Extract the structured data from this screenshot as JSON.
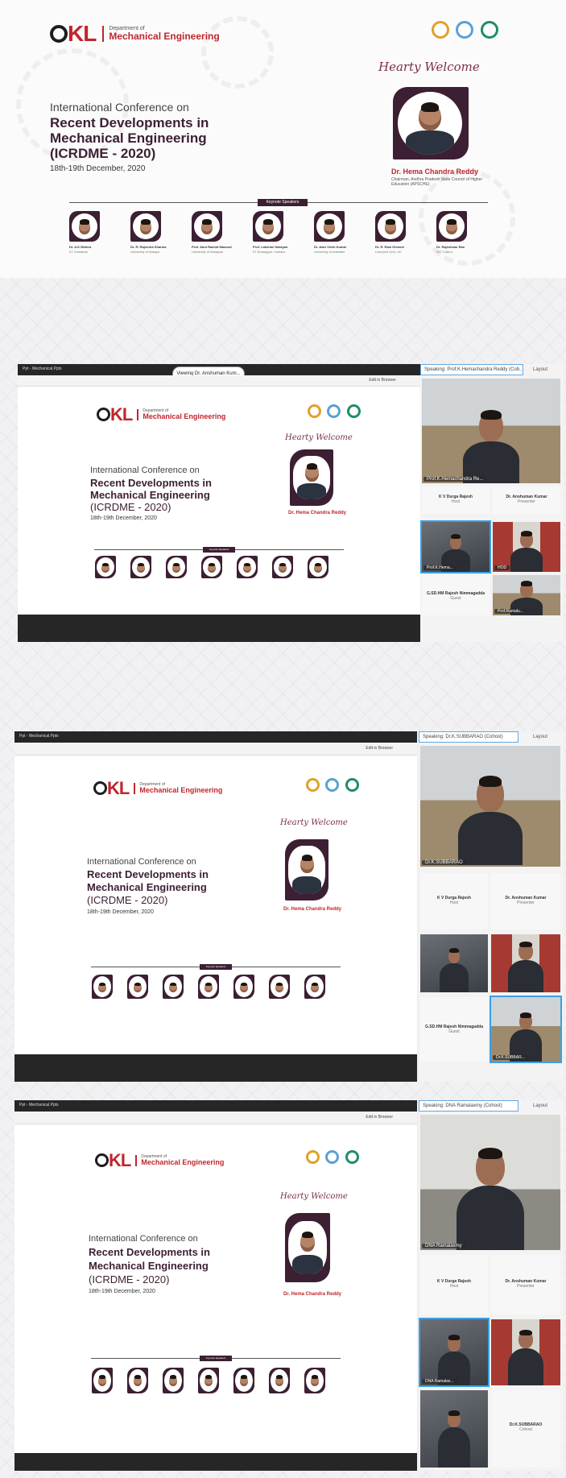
{
  "poster": {
    "logo_text": "KL",
    "logo_o": "O",
    "dept_small": "Department of",
    "dept_big": "Mechanical Engineering",
    "welcome": "Hearty Welcome",
    "conf_line1": "International Conference on",
    "conf_line2": "Recent Developments in",
    "conf_line3": "Mechanical Engineering",
    "conf_line4": "(ICRDME - 2020)",
    "conf_date": "18th-19th December, 2020",
    "chief_name": "Dr. Hema Chandra Reddy",
    "chief_role": "Chairman, Andhra Pradesh State Council of Higher Education (APSCHE)",
    "speakers_tag": "Keynote Speakers",
    "speakers": [
      {
        "name": "Dr. A.K Mishra",
        "aff": "IIT Guwahati"
      },
      {
        "name": "Dr. R. Rajendra Sharma",
        "aff": "University of Malaya"
      },
      {
        "name": "Prof. Abul Rashid Masood",
        "aff": "University of Malaysia"
      },
      {
        "name": "Prof. Lakshmi Narayan",
        "aff": "IIT Kharagpur, Kolkata"
      },
      {
        "name": "Dr. Alan Vivek Kumar",
        "aff": "University of Adelaide"
      },
      {
        "name": "Dr. R. Ram Kishore",
        "aff": "Liverpool Univ, UK"
      },
      {
        "name": "Dr. Rajeshwar Rao",
        "aff": "NIT Calicut"
      }
    ]
  },
  "meetings": [
    {
      "viewing": "Viewing Dr. Anshuman Kum...",
      "speaking": "Speaking: Prof.K.Hemachandra Reddy (Cob...",
      "layout": "Layout",
      "main_label": "Prof.K.Hemachandra Re...",
      "window_title": "Ppt - Mechanical.Pptx",
      "toolbar_right": "Edit in Browser",
      "tiles": [
        {
          "name": "K V Durga Rajesh",
          "role": "Host"
        },
        {
          "name": "Dr. Anshuman Kumar",
          "role": "Presenter"
        }
      ],
      "small_label_1": "Prof.K.Hema...",
      "small_label_2": "HOD",
      "bottom_tile": {
        "name": "G.SD.HM Rajesh Nimmagadda",
        "role": "Guest"
      },
      "bottom_label": "Prof.Ramalu..."
    },
    {
      "speaking": "Speaking: Dr.K.SUBBARAO (Cohost)",
      "layout": "Layout",
      "main_label": "Dr.K.SUBBARAO",
      "window_title": "Ppt - Mechanical.Pptx",
      "toolbar_right": "Edit in Browser",
      "tiles": [
        {
          "name": "K V Durga Rajesh",
          "role": "Host"
        },
        {
          "name": "Dr. Anshuman Kumar",
          "role": "Presenter"
        }
      ],
      "bottom_tile": {
        "name": "G.SD.HM Rajesh Nimmagadda",
        "role": "Guest"
      },
      "small_label": "Dr.K.SUBBAR..."
    },
    {
      "speaking": "Speaking: DNA Ramalaxmy (Cohost)",
      "layout": "Layout",
      "main_label": "DNA Ramalaxmy",
      "window_title": "Ppt - Mechanical.Pptx",
      "toolbar_right": "Edit in Browser",
      "tiles": [
        {
          "name": "K V Durga Rajesh",
          "role": "Host"
        },
        {
          "name": "Dr. Anshuman Kumar",
          "role": "Presenter"
        }
      ],
      "small_label": "DNA Ramalax...",
      "bottom_tile": {
        "name": "Dr.K.SUBBARAO",
        "role": "Cohost"
      }
    }
  ],
  "colors": {
    "brand_red": "#c0262d",
    "brand_maroon": "#3c1f33",
    "active_blue": "#3ba0e6"
  }
}
